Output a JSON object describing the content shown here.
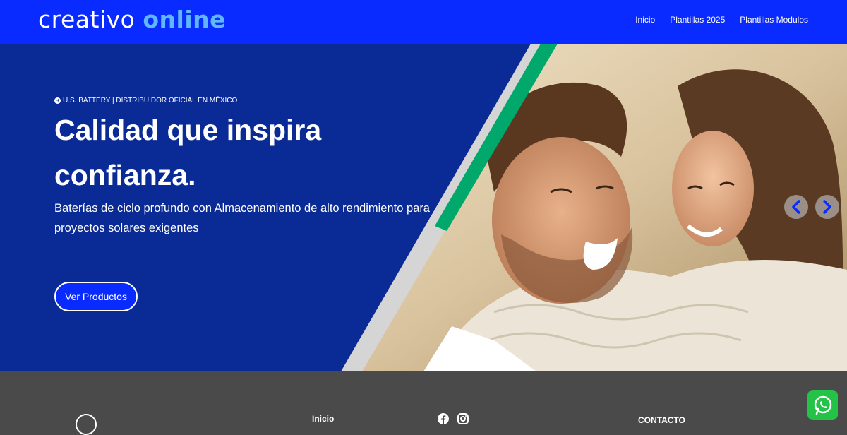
{
  "header": {
    "logo_part1": "creativo",
    "logo_part2": "online",
    "nav": [
      "Inicio",
      "Plantillas 2025",
      "Plantillas Modulos"
    ]
  },
  "hero": {
    "overline": "U.S. BATTERY | DISTRIBUIDOR OFICIAL EN MÉXICO",
    "headline": "Calidad que inspira confianza.",
    "subtitle": "Baterías de ciclo profundo con Almacenamiento de alto rendimiento para proyectos solares exigentes",
    "cta_label": "Ver Productos",
    "image_alt": "smiling couple photo"
  },
  "footer": {
    "inicio": "Inicio",
    "contacto": "CONTACTO"
  },
  "colors": {
    "header_bg": "#0a2bff",
    "hero_bg": "#0a2a96",
    "accent_green": "#00a86b",
    "footer_bg": "#4a4a4a",
    "whatsapp": "#25c248"
  },
  "icons": [
    "arrow-circle-icon",
    "chevron-left-icon",
    "chevron-right-icon",
    "facebook-icon",
    "instagram-icon",
    "whatsapp-icon"
  ]
}
